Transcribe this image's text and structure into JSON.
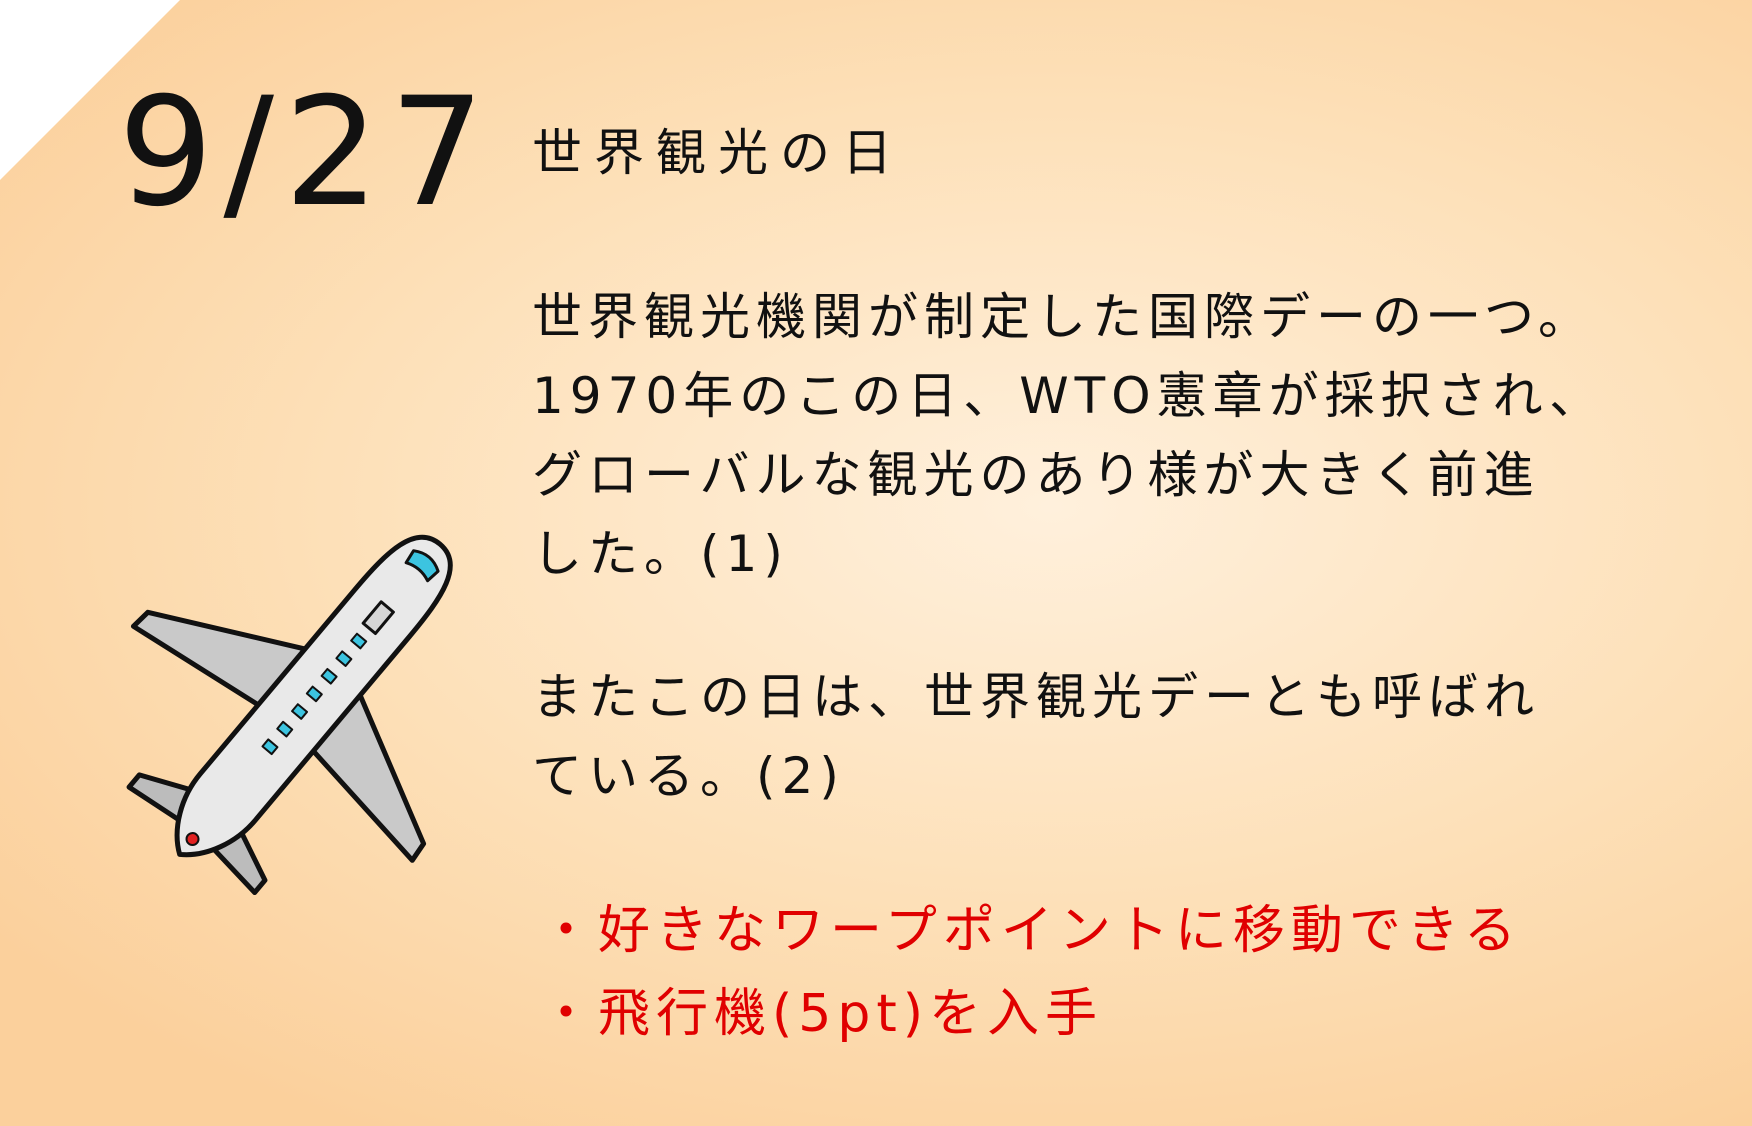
{
  "card": {
    "date": "9/27",
    "title": "世界観光の日",
    "description": [
      "世界観光機関が制定した国際デーの一つ。",
      "1970年のこの日、WTO憲章が採択され、",
      "グローバルな観光のあり様が大きく前進",
      "した。(1)"
    ],
    "note": [
      "またこの日は、世界観光デーとも呼ばれ",
      "ている。(2)"
    ],
    "rewards": [
      "・好きなワープポイントに移動できる",
      "・飛行機(5pt)を入手"
    ],
    "illustration": "airplane-icon",
    "colors": {
      "background": "#fde0b8",
      "text": "#111111",
      "reward_text": "#e00000"
    }
  }
}
